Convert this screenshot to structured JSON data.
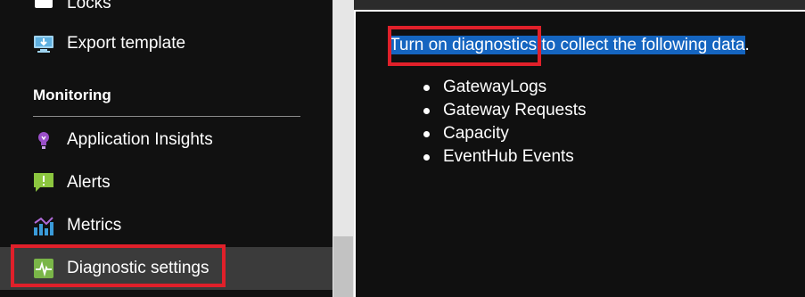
{
  "sidebar": {
    "items_top": [
      {
        "label": "Locks",
        "icon": "lock-icon"
      },
      {
        "label": "Export template",
        "icon": "export-template-icon"
      }
    ],
    "section_title": "Monitoring",
    "monitoring_items": [
      {
        "label": "Application Insights",
        "icon": "lightbulb-icon"
      },
      {
        "label": "Alerts",
        "icon": "alert-icon"
      },
      {
        "label": "Metrics",
        "icon": "metrics-icon"
      },
      {
        "label": "Diagnostic settings",
        "icon": "diagnostic-settings-icon",
        "selected": true
      }
    ]
  },
  "panel": {
    "intro_link": "Turn on diagnostics",
    "intro_rest_highlighted": " to collect the following data",
    "intro_period": ".",
    "bullets": [
      "GatewayLogs",
      "Gateway Requests",
      "Capacity",
      "EventHub Events"
    ]
  },
  "colors": {
    "highlight_red": "#e0202a",
    "text_selection": "#1565c0",
    "selected_item_bg": "#3b3b3b"
  }
}
